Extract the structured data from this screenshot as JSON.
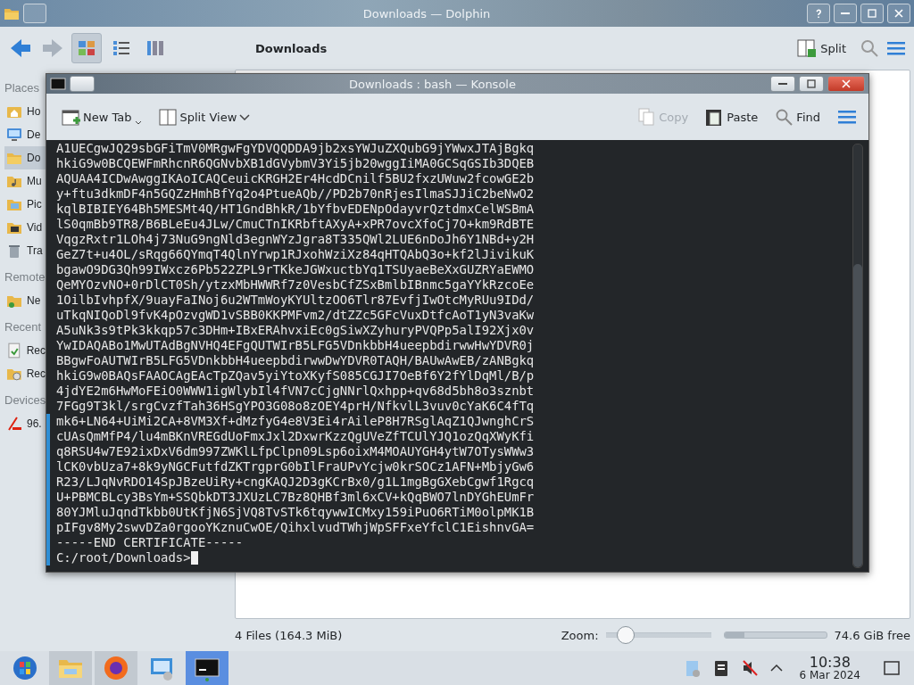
{
  "dolphin": {
    "title": "Downloads — Dolphin",
    "toolbar": {
      "view_modes": [
        {
          "kind": "icons",
          "selected": true
        },
        {
          "kind": "compact",
          "selected": false
        },
        {
          "kind": "details",
          "selected": false
        }
      ],
      "breadcrumb": "Downloads",
      "split": "Split"
    },
    "sidebar": [
      {
        "title": "Places",
        "items": [
          {
            "kind": "home",
            "label": "Ho",
            "selected": false
          },
          {
            "kind": "desktop",
            "label": "De",
            "selected": false
          },
          {
            "kind": "folder",
            "label": "Do",
            "selected": true
          },
          {
            "kind": "music",
            "label": "Mu",
            "selected": false
          },
          {
            "kind": "pictures",
            "label": "Pic",
            "selected": false
          },
          {
            "kind": "videos",
            "label": "Vid",
            "selected": false
          },
          {
            "kind": "trash",
            "label": "Tra",
            "selected": false
          }
        ]
      },
      {
        "title": "Remote",
        "items": [
          {
            "kind": "network",
            "label": "Ne",
            "selected": false
          }
        ]
      },
      {
        "title": "Recent",
        "items": [
          {
            "kind": "recent-files",
            "label": "Rec",
            "selected": false
          },
          {
            "kind": "recent-locations",
            "label": "Rec",
            "selected": false
          }
        ]
      },
      {
        "title": "Devices",
        "items": [
          {
            "kind": "drive",
            "label": "96.",
            "selected": false
          }
        ]
      }
    ],
    "status": "4 Files (164.3 MiB)",
    "zoom": {
      "label": "Zoom:",
      "level": 0.12
    },
    "free_space": {
      "text": "74.6 GiB free",
      "level": 0.2
    }
  },
  "konsole": {
    "title": "Downloads : bash — Konsole",
    "toolbar": [
      {
        "kind": "new-tab",
        "label": "New Tab",
        "disabled": false
      },
      {
        "kind": "split-view",
        "label": "Split View",
        "disabled": false
      },
      {
        "kind": "copy",
        "label": "Copy",
        "disabled": true
      },
      {
        "kind": "paste",
        "label": "Paste",
        "disabled": false
      },
      {
        "kind": "find",
        "label": "Find",
        "disabled": false
      }
    ],
    "lines": [
      {
        "text": "A1UECgwJQ29sbGFiTmV0MRgwFgYDVQQDDA9jb2xsYWJuZXQubG9jYWwxJTAjBgkq",
        "marked": false
      },
      {
        "text": "hkiG9w0BCQEWFmRhcnR6QGNvbXB1dGVybmV3Yi5jb20wggIiMA0GCSqGSIb3DQEB",
        "marked": false
      },
      {
        "text": "AQUAA4ICDwAwggIKAoICAQCeuicKRGH2Er4HcdDCnilf5BU2fxzUWuw2fcowGE2b",
        "marked": false
      },
      {
        "text": "y+ftu3dkmDF4n5GQZzHmhBfYq2o4PtueAQb//PD2b70nRjesIlmaSJJiC2beNwO2",
        "marked": false
      },
      {
        "text": "kqlBIBIEY64Bh5MESMt4Q/HT1GndBhkR/1bYfbvEDENpOdayvrQztdmxCelWSBmA",
        "marked": false
      },
      {
        "text": "lS0qmBb9TR8/B6BLeEu4JLw/CmuCTnIKRbftAXyA+xPR7ovcXfoCj7O+km9RdBTE",
        "marked": false
      },
      {
        "text": "VqgzRxtr1LOh4j73NuG9ngNld3egnWYzJgra8T335QWl2LUE6nDoJh6Y1NBd+y2H",
        "marked": false
      },
      {
        "text": "GeZ7t+u4OL/sRqg66QYmqT4QlnYrwp1RJxohWziXz84qHTQAbQ3o+kf2lJivikuK",
        "marked": false
      },
      {
        "text": "bgawO9DG3Qh99IWxcz6Pb522ZPL9rTKkeJGWxuctbYq1TSUyaeBeXxGUZRYaEWMO",
        "marked": false
      },
      {
        "text": "QeMYOzvNO+0rDlCT0Sh/ytzxMbHWWRf7z0VesbCfZSxBmlbIBnmc5gaYYkRzcoEe",
        "marked": false
      },
      {
        "text": "1OilbIvhpfX/9uayFaINoj6u2WTmWoyKYUltzOO6Tlr87EvfjIwOtcMyRUu9IDd/",
        "marked": false
      },
      {
        "text": "uTkqNIQoDl9fvK4pOzvgWD1vSBB0KKPMFvm2/dtZZc5GFcVuxDtfcAoT1yN3vaKw",
        "marked": false
      },
      {
        "text": "A5uNk3s9tPk3kkqp57c3DHm+IBxERAhvxiEc0gSiwXZyhuryPVQPp5alI92Xjx0v",
        "marked": false
      },
      {
        "text": "YwIDAQABo1MwUTAdBgNVHQ4EFgQUTWIrB5LFG5VDnkbbH4ueepbdirwwHwYDVR0j",
        "marked": false
      },
      {
        "text": "BBgwFoAUTWIrB5LFG5VDnkbbH4ueepbdirwwDwYDVR0TAQH/BAUwAwEB/zANBgkq",
        "marked": false
      },
      {
        "text": "hkiG9w0BAQsFAAOCAgEAcTpZQav5yiYtoXKyfS085CGJI7OeBf6Y2fYlDqMl/B/p",
        "marked": false
      },
      {
        "text": "4jdYE2m6HwMoFEiO0WWW1igWlybIl4fVN7cCjgNNrlQxhpp+qv68d5bh8o3sznbt",
        "marked": false
      },
      {
        "text": "7FGg9T3kl/srgCvzfTah36HSgYPO3G08o8zOEY4prH/NfkvlL3vuv0cYaK6C4fTq",
        "marked": false
      },
      {
        "text": "mk6+LN64+UiMi2CA+8VM3Xf+dMzfyG4e8V3Ei4rAileP8H7RSglAqZ1QJwnghCrS",
        "marked": true
      },
      {
        "text": "cUAsQmMfP4/lu4mBKnVREGdUoFmxJxl2DxwrKzzQgUVeZfTCUlYJQ1ozQqXWyKfi",
        "marked": true
      },
      {
        "text": "q8RSU4w7E92ixDxV6dm997ZWKlLfpClpn09Lsp6oixM4MOAUYGH4ytW7OTysWWw3",
        "marked": true
      },
      {
        "text": "lCK0vbUza7+8k9yNGCFutfdZKTrgprG0bIlFraUPvYcjw0krSOCz1AFN+MbjyGw6",
        "marked": true
      },
      {
        "text": "R23/LJqNvRDO14SpJBzeUiRy+cngKAQJ2D3gKCrBx0/g1L1mgBgGXebCgwf1Rgcq",
        "marked": true
      },
      {
        "text": "U+PBMCBLcy3BsYm+SSQbkDT3JXUzLC7Bz8QHBf3ml6xCV+kQqBWO7lnDYGhEUmFr",
        "marked": true
      },
      {
        "text": "80YJMluJqndTkbb0UtKfjN6SjVQ8TvSTk6tqywwICMxy159iPuO6RTiM0olpMK1B",
        "marked": true
      },
      {
        "text": "pIFgv8My2swvDZa0rgooYKznuCwOE/QihxlvudTWhjWpSFFxeYfclC1EishnvGA=",
        "marked": true
      },
      {
        "text": "-----END CERTIFICATE-----",
        "marked": true
      },
      {
        "text": "C:/root/Downloads>",
        "marked": true
      }
    ]
  },
  "taskbar": {
    "apps": [
      {
        "kind": "start",
        "running": false,
        "selected": false
      },
      {
        "kind": "files",
        "running": true,
        "selected": false
      },
      {
        "kind": "browser",
        "running": true,
        "selected": false
      },
      {
        "kind": "settings",
        "running": false,
        "selected": false
      },
      {
        "kind": "terminal",
        "running": true,
        "selected": true
      }
    ],
    "clock": {
      "time": "10:38",
      "date": "6 Mar 2024"
    }
  }
}
